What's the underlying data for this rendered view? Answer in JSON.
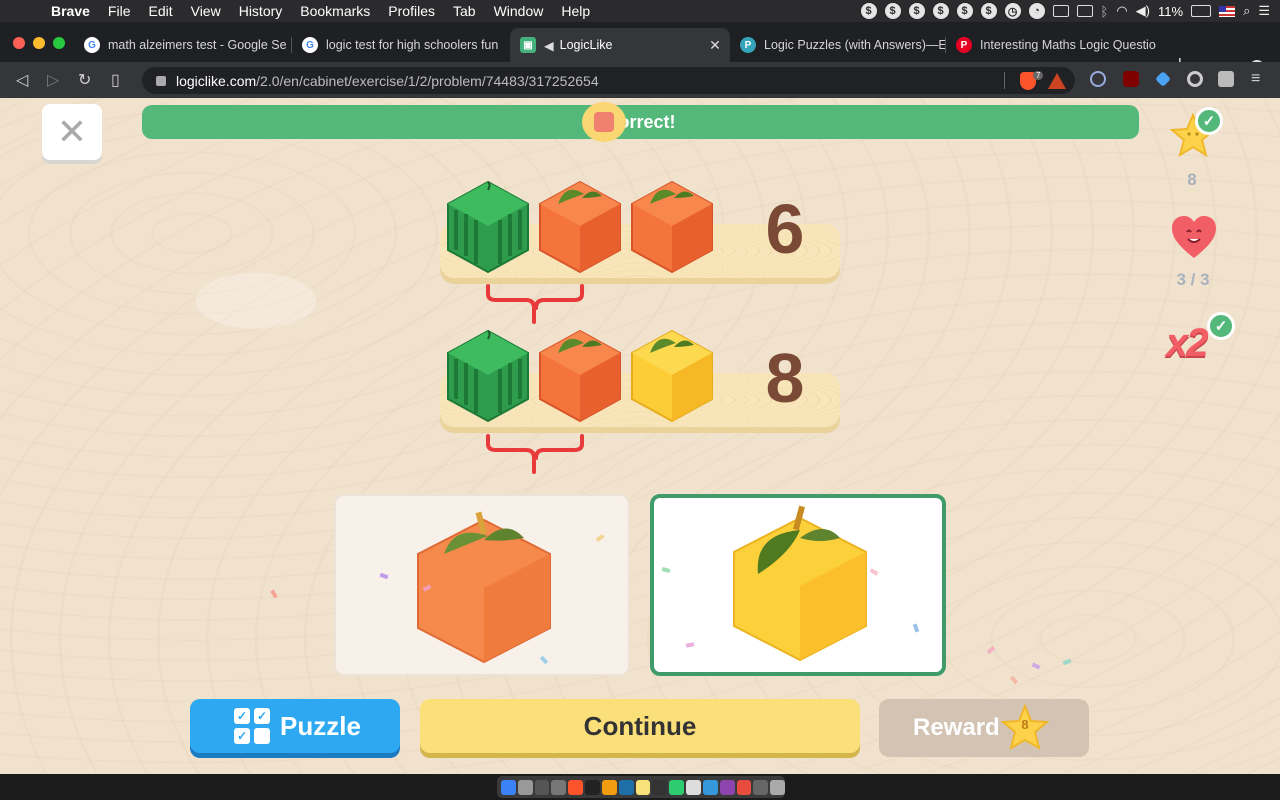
{
  "menubar": {
    "app_name": "Brave",
    "items": [
      "File",
      "Edit",
      "View",
      "History",
      "Bookmarks",
      "Profiles",
      "Tab",
      "Window",
      "Help"
    ],
    "battery": "11%"
  },
  "tabs": [
    {
      "title": "math alzeimers test - Google Se",
      "favicon": "google-icon"
    },
    {
      "title": "logic test for high schoolers fun",
      "favicon": "google-icon"
    },
    {
      "title": "LogicLike",
      "favicon": "logiclike-icon",
      "active": true
    },
    {
      "title": "Logic Puzzles (with Answers)—E",
      "favicon": "p-icon"
    },
    {
      "title": "Interesting Maths Logic Questio",
      "favicon": "pinterest-icon"
    }
  ],
  "toolbar": {
    "url_host": "logiclike.com",
    "url_path": "/2.0/en/cabinet/exercise/1/2/problem/74483/317252654",
    "shield_count": "7"
  },
  "page": {
    "banner_text": "Correct!",
    "close_symbol": "✕",
    "stars_count": "8",
    "lives": "3 / 3",
    "multiplier": "x2",
    "puzzle_rows": [
      {
        "fruits": [
          "watermelon",
          "orange",
          "orange"
        ],
        "total": "6"
      },
      {
        "fruits": [
          "watermelon",
          "orange",
          "lemon"
        ],
        "total": "8"
      }
    ],
    "answers": [
      {
        "fruit": "orange",
        "selected": false
      },
      {
        "fruit": "lemon",
        "selected": true
      }
    ],
    "buttons": {
      "puzzle": "Puzzle",
      "continue": "Continue",
      "reward": "Reward",
      "reward_value": "8"
    }
  },
  "colors": {
    "correct_green": "#54b87a",
    "puzzle_blue": "#2ea8f1",
    "continue_yellow": "#fbe07a",
    "orange_cube": "#f4743b",
    "lemon_cube": "#fccd37",
    "watermelon_cube": "#2f9f4e"
  }
}
